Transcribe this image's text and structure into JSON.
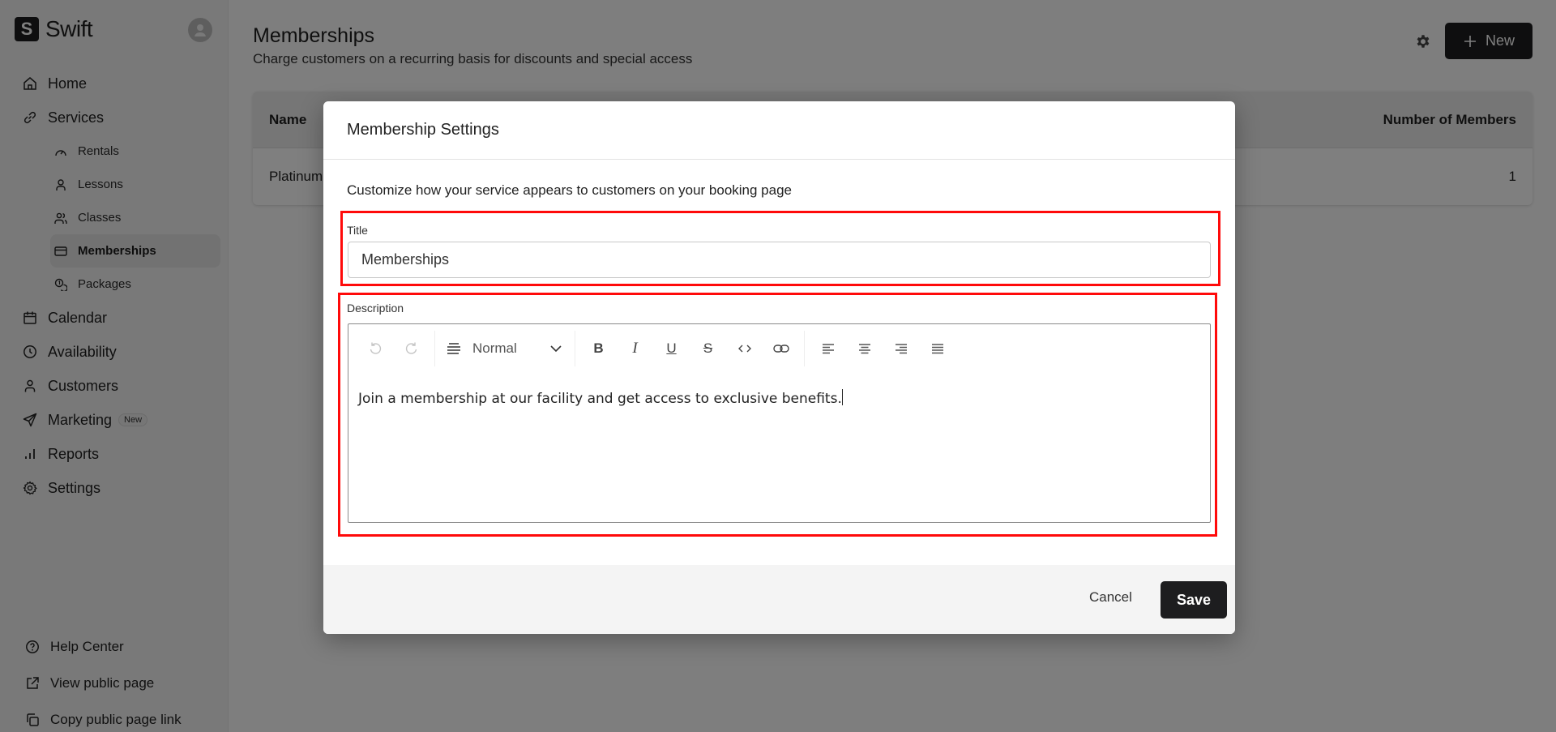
{
  "app": {
    "name": "Swift",
    "logo_letter": "S"
  },
  "sidebar": {
    "items": [
      {
        "label": "Home",
        "icon": "home-icon"
      },
      {
        "label": "Services",
        "icon": "link-icon"
      },
      {
        "label": "Calendar",
        "icon": "calendar-icon"
      },
      {
        "label": "Availability",
        "icon": "clock-icon"
      },
      {
        "label": "Customers",
        "icon": "user-icon"
      },
      {
        "label": "Marketing",
        "icon": "send-icon",
        "badge": "New"
      },
      {
        "label": "Reports",
        "icon": "bar-chart-icon"
      },
      {
        "label": "Settings",
        "icon": "gear-icon"
      }
    ],
    "services_sub": [
      {
        "label": "Rentals",
        "icon": "gauge-icon"
      },
      {
        "label": "Lessons",
        "icon": "user-icon"
      },
      {
        "label": "Classes",
        "icon": "users-icon"
      },
      {
        "label": "Memberships",
        "icon": "card-icon",
        "active": true
      },
      {
        "label": "Packages",
        "icon": "coins-icon"
      }
    ],
    "bottom": [
      {
        "label": "Help Center",
        "icon": "help-circle-icon"
      },
      {
        "label": "View public page",
        "icon": "external-link-icon"
      },
      {
        "label": "Copy public page link",
        "icon": "copy-icon"
      }
    ]
  },
  "page": {
    "title": "Memberships",
    "subtitle": "Charge customers on a recurring basis for discounts and special access",
    "new_button": "New",
    "table": {
      "columns": [
        "Name",
        "Number of Members"
      ],
      "rows": [
        {
          "name": "Platinum",
          "members": "1"
        }
      ]
    }
  },
  "modal": {
    "title": "Membership Settings",
    "description": "Customize how your service appears to customers on your booking page",
    "title_label": "Title",
    "title_value": "Memberships",
    "description_label": "Description",
    "format_value": "Normal",
    "description_value": "Join a membership at our facility and get access to exclusive benefits.",
    "cancel_label": "Cancel",
    "save_label": "Save",
    "highlight_color": "#ff0a0a"
  }
}
